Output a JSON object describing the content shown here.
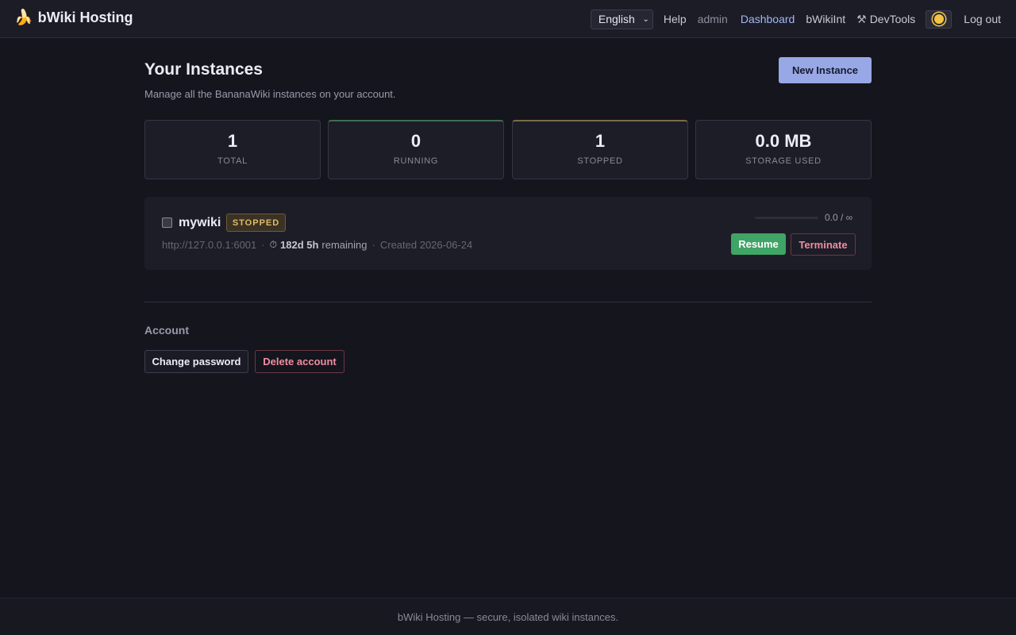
{
  "header": {
    "logo_icon": "banana-icon",
    "logo_glyph": "🍌",
    "title": "bWiki Hosting",
    "language": "English",
    "help": "Help",
    "user": "admin",
    "dashboard": "Dashboard",
    "bwikiint": "bWikiInt",
    "devtools_icon": "hammer-wrench-icon",
    "devtools": "DevTools",
    "theme_icon": "sun-icon",
    "logout": "Log out"
  },
  "page": {
    "title": "Your Instances",
    "subtitle": "Manage all the BananaWiki instances on your account.",
    "new_button": "New Instance"
  },
  "stats": [
    {
      "value": "1",
      "label": "TOTAL"
    },
    {
      "value": "0",
      "label": "RUNNING"
    },
    {
      "value": "1",
      "label": "STOPPED"
    },
    {
      "value": "0.0 MB",
      "label": "STORAGE USED"
    }
  ],
  "instances": [
    {
      "name": "mywiki",
      "status": "STOPPED",
      "url": "http://127.0.0.1:6001",
      "remaining_value": "182d 5h",
      "remaining_text": "remaining",
      "created": "Created 2026-06-24",
      "usage": "0.0 / ∞",
      "usage_fraction": 0,
      "resume": "Resume",
      "terminate": "Terminate"
    }
  ],
  "account": {
    "title": "Account",
    "change_password": "Change password",
    "delete_account": "Delete account"
  },
  "footer": {
    "text": "bWiki Hosting — secure, isolated wiki instances."
  },
  "colors": {
    "background": "#15151e",
    "accent": "#98a8e6",
    "running": "#3fa466",
    "stopped": "#e0bb6a",
    "danger": "#f08da0"
  }
}
